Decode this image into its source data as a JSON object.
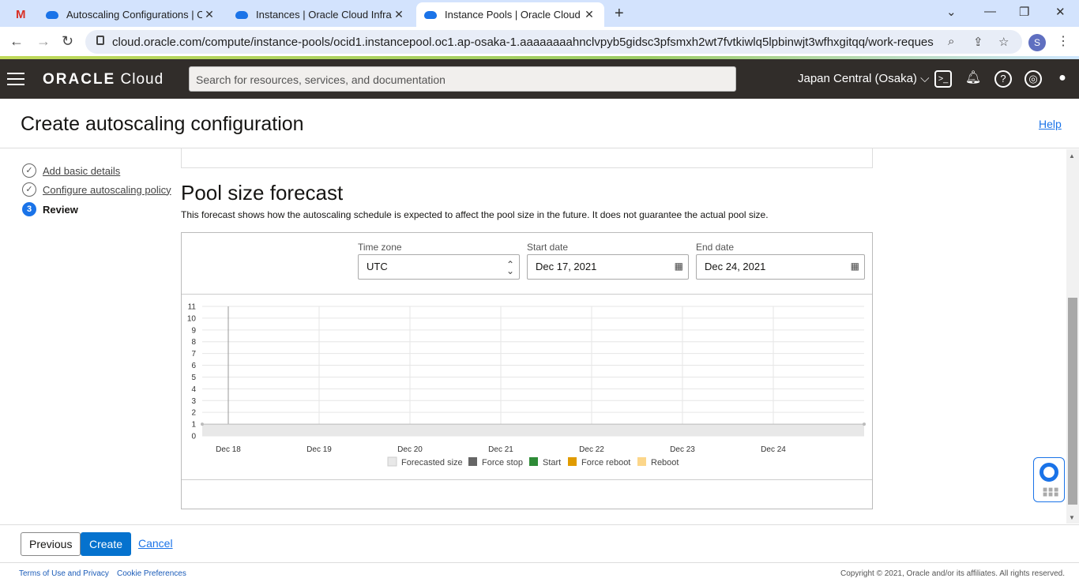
{
  "browser": {
    "tabs": [
      {
        "title": "Autoscaling Configurations | Ora"
      },
      {
        "title": "Instances | Oracle Cloud Infrastru"
      },
      {
        "title": "Instance Pools | Oracle Cloud Infr"
      }
    ],
    "gmail_icon": "M",
    "new_tab": "+",
    "url": "cloud.oracle.com/compute/instance-pools/ocid1.instancepool.oc1.ap-osaka-1.aaaaaaaahnclvpyb5gidsc3pfsmxh2wt7fvtkiwlq5lpbinwjt3wfhxgitqq/work-requests?region...",
    "profile_initial": "S"
  },
  "header": {
    "logo_brand": "ORACLE",
    "logo_product": " Cloud",
    "search_placeholder": "Search for resources, services, and documentation",
    "region": "Japan Central (Osaka)"
  },
  "page": {
    "title": "Create autoscaling configuration",
    "help": "Help"
  },
  "steps": [
    {
      "num": "✓",
      "label": "Add basic details"
    },
    {
      "num": "✓",
      "label": "Configure autoscaling policy"
    },
    {
      "num": "3",
      "label": "Review"
    }
  ],
  "forecast": {
    "heading": "Pool size forecast",
    "description": "This forecast shows how the autoscaling schedule is expected to affect the pool size in the future. It does not guarantee the actual pool size.",
    "timezone_label": "Time zone",
    "timezone_value": "UTC",
    "start_label": "Start date",
    "start_value": "Dec 17, 2021",
    "end_label": "End date",
    "end_value": "Dec 24, 2021"
  },
  "chart_data": {
    "type": "area",
    "x": [
      "Dec 17",
      "Dec 24"
    ],
    "x_ticks": [
      "Dec 18",
      "Dec 19",
      "Dec 20",
      "Dec 21",
      "Dec 22",
      "Dec 23",
      "Dec 24"
    ],
    "y_ticks": [
      "0",
      "1",
      "2",
      "3",
      "4",
      "5",
      "6",
      "7",
      "8",
      "9",
      "10",
      "11"
    ],
    "ylim": [
      0,
      11
    ],
    "series": [
      {
        "name": "Forecasted size",
        "values": [
          1,
          1
        ],
        "color": "#e8e8e8"
      },
      {
        "name": "Force stop",
        "values": [],
        "color": "#666666"
      },
      {
        "name": "Start",
        "values": [],
        "color": "#2e8b37"
      },
      {
        "name": "Force reboot",
        "values": [],
        "color": "#e09b00"
      },
      {
        "name": "Reboot",
        "values": [],
        "color": "#fcd68a"
      }
    ],
    "grid": true,
    "legend": "bottom"
  },
  "footer": {
    "previous": "Previous",
    "create": "Create",
    "cancel": "Cancel",
    "terms": "Terms of Use and Privacy",
    "cookies": "Cookie Preferences",
    "copyright": "Copyright © 2021, Oracle and/or its affiliates. All rights reserved."
  }
}
